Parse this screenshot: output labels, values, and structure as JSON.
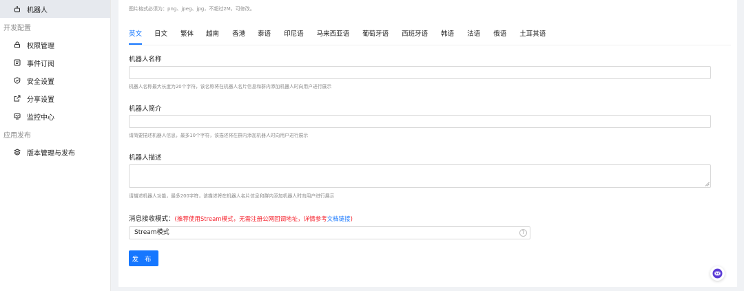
{
  "sidebar": {
    "items": [
      {
        "label": "机器人",
        "icon": "robot-icon",
        "active": true
      },
      {
        "group": "开发配置"
      },
      {
        "label": "权限管理",
        "icon": "lock-icon"
      },
      {
        "label": "事件订阅",
        "icon": "event-icon"
      },
      {
        "label": "安全设置",
        "icon": "shield-icon"
      },
      {
        "label": "分享设置",
        "icon": "share-icon"
      },
      {
        "label": "监控中心",
        "icon": "monitor-icon"
      },
      {
        "group": "应用发布"
      },
      {
        "label": "版本管理与发布",
        "icon": "layers-icon"
      }
    ]
  },
  "main": {
    "image_hint": "图片格式必须为：png、jpeg、jpg，不超过2M，可修改。",
    "tabs": [
      "英文",
      "日文",
      "繁体",
      "越南",
      "香港",
      "泰语",
      "印尼语",
      "马来西亚语",
      "葡萄牙语",
      "西班牙语",
      "韩语",
      "法语",
      "俄语",
      "土耳其语"
    ],
    "active_tab": "英文",
    "name": {
      "label": "机器人名称",
      "value": "",
      "help": "机器人名称最大长度为20个字符，该名称将在机器人名片信息和群内添加机器人时向用户进行展示"
    },
    "intro": {
      "label": "机器人简介",
      "value": "",
      "help": "请简要描述机器人信息，最多10个字符，该描述将在群内添加机器人时向用户进行展示"
    },
    "description": {
      "label": "机器人描述",
      "value": "",
      "help": "请描述机器人功能，最多200字符，该描述将在机器人名片信息和群内添加机器人时向用户进行展示"
    },
    "mode": {
      "label": "消息接收模式：",
      "note_prefix": "(推荐使用Stream模式，无需注册公网回调地址，详情参考",
      "link": "文档链接",
      "note_suffix": ")",
      "value": "Stream模式",
      "help_icon": "?"
    },
    "publish_label": "发 布"
  },
  "colors": {
    "accent": "#1677ff",
    "warning": "#f5222d",
    "sidebar_active": "#e6e9ee",
    "background": "#f0f2f5"
  }
}
